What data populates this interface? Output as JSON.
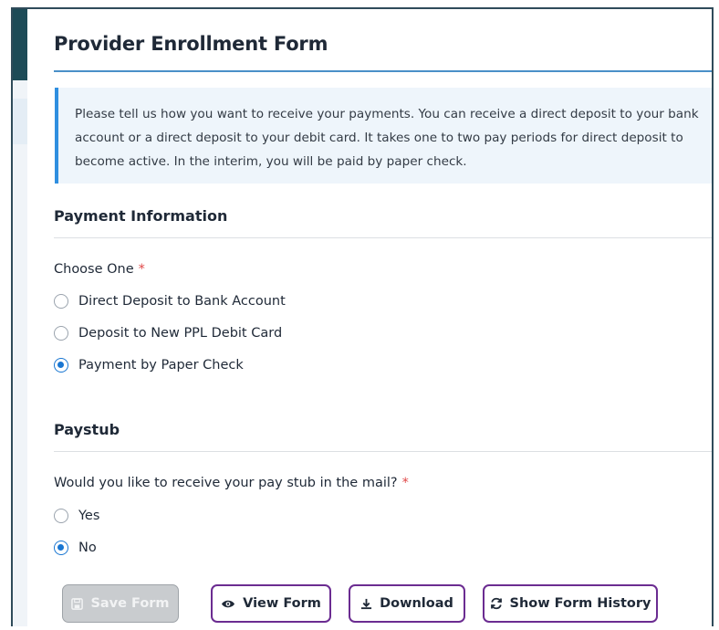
{
  "form": {
    "title": "Provider Enrollment Form",
    "intro": "Please tell us how you want to receive your payments. You can receive a direct deposit to your bank account or a direct deposit to your debit card. It takes one to two pay periods for direct deposit to become active. In the interim, you will be paid by paper check."
  },
  "payment": {
    "section_title": "Payment Information",
    "question": "Choose One",
    "required_mark": "*",
    "options": [
      {
        "label": "Direct Deposit to Bank Account",
        "checked": false
      },
      {
        "label": "Deposit to New PPL Debit Card",
        "checked": false
      },
      {
        "label": "Payment by Paper Check",
        "checked": true
      }
    ]
  },
  "paystub": {
    "section_title": "Paystub",
    "question": "Would you like to receive your pay stub in the mail?",
    "required_mark": "*",
    "options": [
      {
        "label": "Yes",
        "checked": false
      },
      {
        "label": "No",
        "checked": true
      }
    ]
  },
  "actions": {
    "save_label": "Save Form",
    "view_label": "View Form",
    "download_label": "Download",
    "history_label": "Show Form History"
  },
  "colors": {
    "accent": "#6b2c91",
    "radio_checked": "#1976d2",
    "info_border": "#2f8fe0",
    "required": "#e04848"
  },
  "icons": {
    "save": "floppy-disk-icon",
    "view": "eye-icon",
    "download": "download-icon",
    "history": "refresh-icon"
  }
}
